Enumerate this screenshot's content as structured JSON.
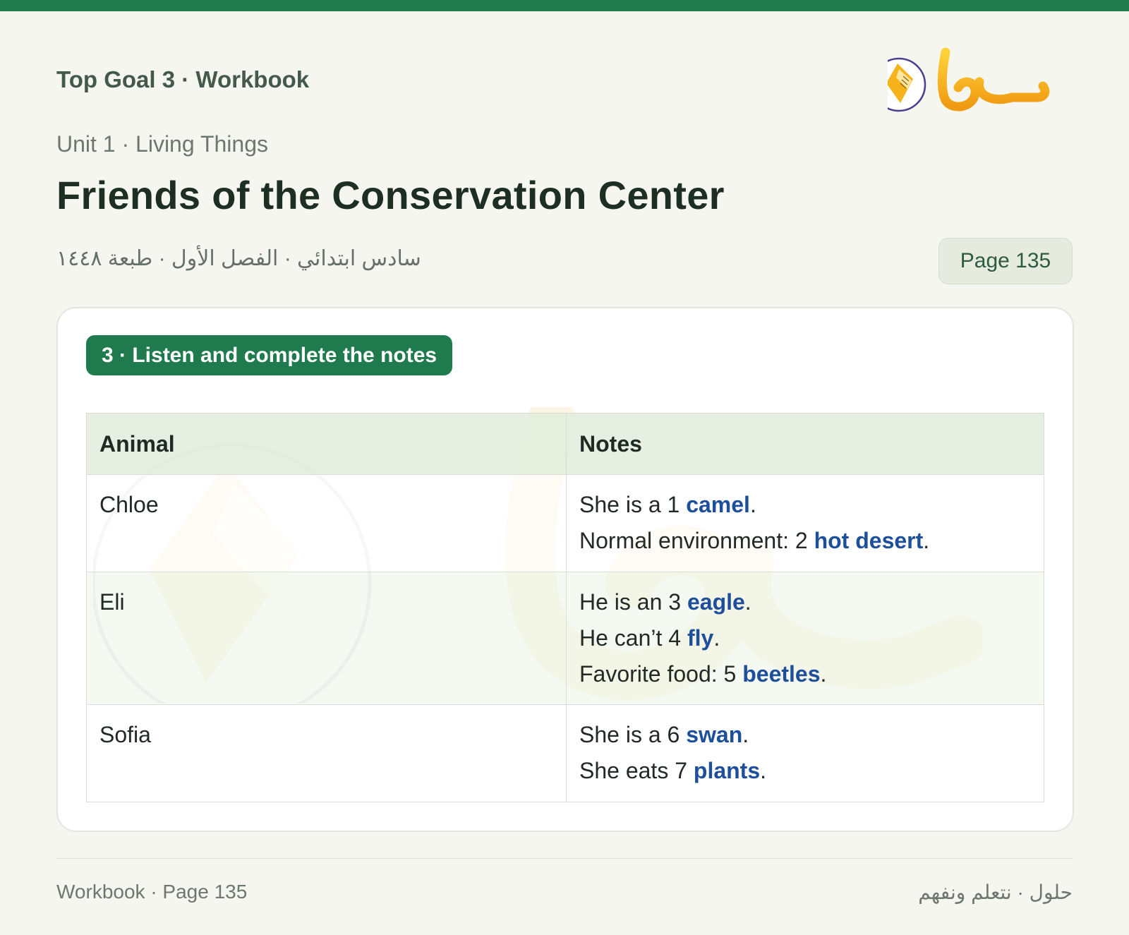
{
  "header": {
    "book_title": "Top Goal 3 · Workbook",
    "logo_text": "حلول",
    "unit_line": "Unit 1 · Living Things",
    "lesson_title": "Friends of the Conservation Center",
    "arabic_meta": "سادس ابتدائي · الفصل الأول · طبعة ١٤٤٨",
    "page_badge": "Page 135"
  },
  "exercise": {
    "label": "3 · Listen and complete the notes"
  },
  "table": {
    "headers": [
      "Animal",
      "Notes"
    ],
    "rows": [
      {
        "animal": "Chloe",
        "notes": [
          {
            "before": "She is a 1 ",
            "answer": "camel",
            "after": "."
          },
          {
            "before": "Normal environment: 2 ",
            "answer": "hot desert",
            "after": "."
          }
        ]
      },
      {
        "animal": "Eli",
        "notes": [
          {
            "before": "He is an 3 ",
            "answer": "eagle",
            "after": "."
          },
          {
            "before": "He can’t 4 ",
            "answer": "fly",
            "after": "."
          },
          {
            "before": "Favorite food: 5 ",
            "answer": "beetles",
            "after": "."
          }
        ]
      },
      {
        "animal": "Sofia",
        "notes": [
          {
            "before": "She is a 6 ",
            "answer": "swan",
            "after": "."
          },
          {
            "before": "She eats 7 ",
            "answer": "plants",
            "after": "."
          }
        ]
      }
    ]
  },
  "footer": {
    "left": "Workbook · Page 135",
    "right": "حلول · نتعلم ونفهم"
  },
  "colors": {
    "brand_green": "#1f7a4d",
    "answer_blue": "#1e4f9a",
    "logo_gold": "#f2a516",
    "logo_ring": "#4a3f8c"
  }
}
